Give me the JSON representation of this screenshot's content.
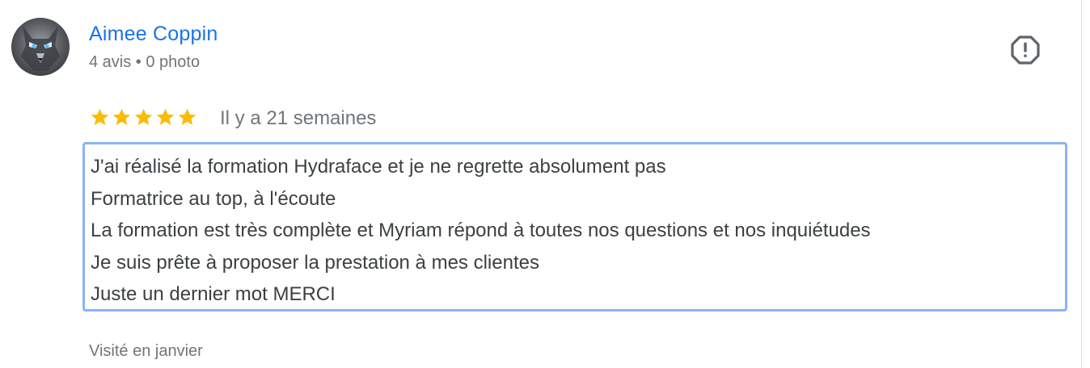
{
  "review": {
    "author": {
      "name": "Aimee Coppin",
      "meta": "4 avis • 0 photo",
      "avatar_icon": "wolf-avatar"
    },
    "report_icon": "report-icon",
    "rating": 5,
    "rating_color": "#fbbc04",
    "date": "Il y a 21 semaines",
    "text_lines": [
      "J'ai réalisé la formation Hydraface et je ne regrette absolument pas",
      "Formatrice au top, à l'écoute",
      "La formation est très complète et Myriam répond à toutes nos questions et nos inquiétudes",
      "Je suis prête à proposer la prestation à mes clientes",
      "Juste un dernier mot MERCI"
    ],
    "visit": "Visité en janvier"
  },
  "colors": {
    "link": "#1a73e8",
    "secondary_text": "#70757a",
    "body_text": "#3c4043",
    "focus_border": "#8ab4f8"
  }
}
